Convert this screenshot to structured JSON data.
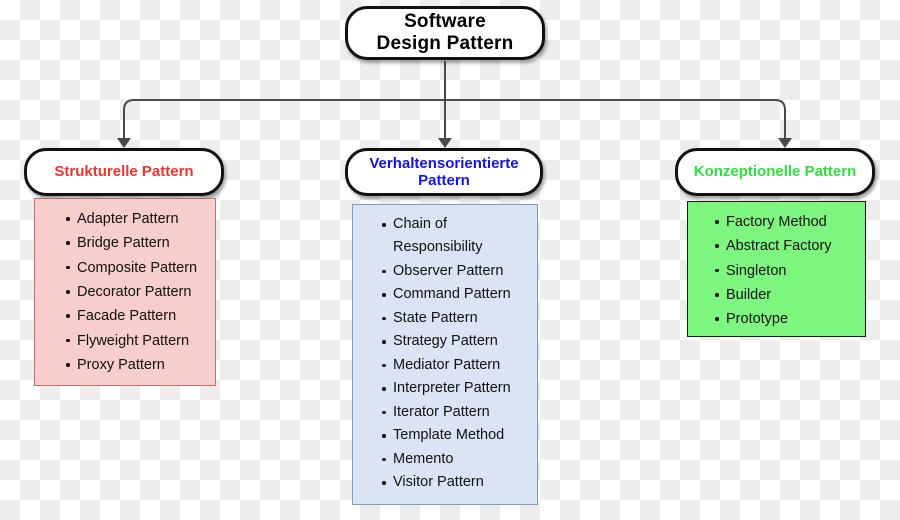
{
  "diagram": {
    "root": {
      "label_line1": "Software",
      "label_line2": "Design Pattern",
      "text_color": "#000000",
      "fill": "#ffffff"
    },
    "connector": {
      "color": "#4a4a4a",
      "style": "orthogonal-elbow-with-arrowheads"
    },
    "branches": [
      {
        "id": "structural",
        "header_label": "Strukturelle Pattern",
        "header_text_color": "#f2312f",
        "panel_fill": "#f6cfcd",
        "panel_border": "#c46f6c",
        "items": [
          "Adapter Pattern",
          "Bridge Pattern",
          "Composite Pattern",
          "Decorator Pattern",
          "Facade Pattern",
          "Flyweight Pattern",
          "Proxy Pattern"
        ]
      },
      {
        "id": "behavioral",
        "header_label_line1": "Verhaltensorientierte",
        "header_label_line2": "Pattern",
        "header_text_color": "#1414e6",
        "panel_fill": "#dae4f4",
        "panel_border": "#7e9bc4",
        "items": [
          "Chain of Responsibility",
          "Observer Pattern",
          "Command Pattern",
          "State Pattern",
          "Strategy Pattern",
          "Mediator Pattern",
          "Interpreter Pattern",
          "Iterator Pattern",
          "Template Method",
          "Memento",
          "Visitor Pattern"
        ]
      },
      {
        "id": "creational",
        "header_label": "Konzeptionelle Pattern",
        "header_text_color": "#2de03c",
        "panel_fill": "#7df67f",
        "panel_border": "#1b1b1b",
        "items": [
          "Factory Method",
          "Abstract Factory",
          "Singleton",
          "Builder",
          "Prototype"
        ]
      }
    ]
  }
}
